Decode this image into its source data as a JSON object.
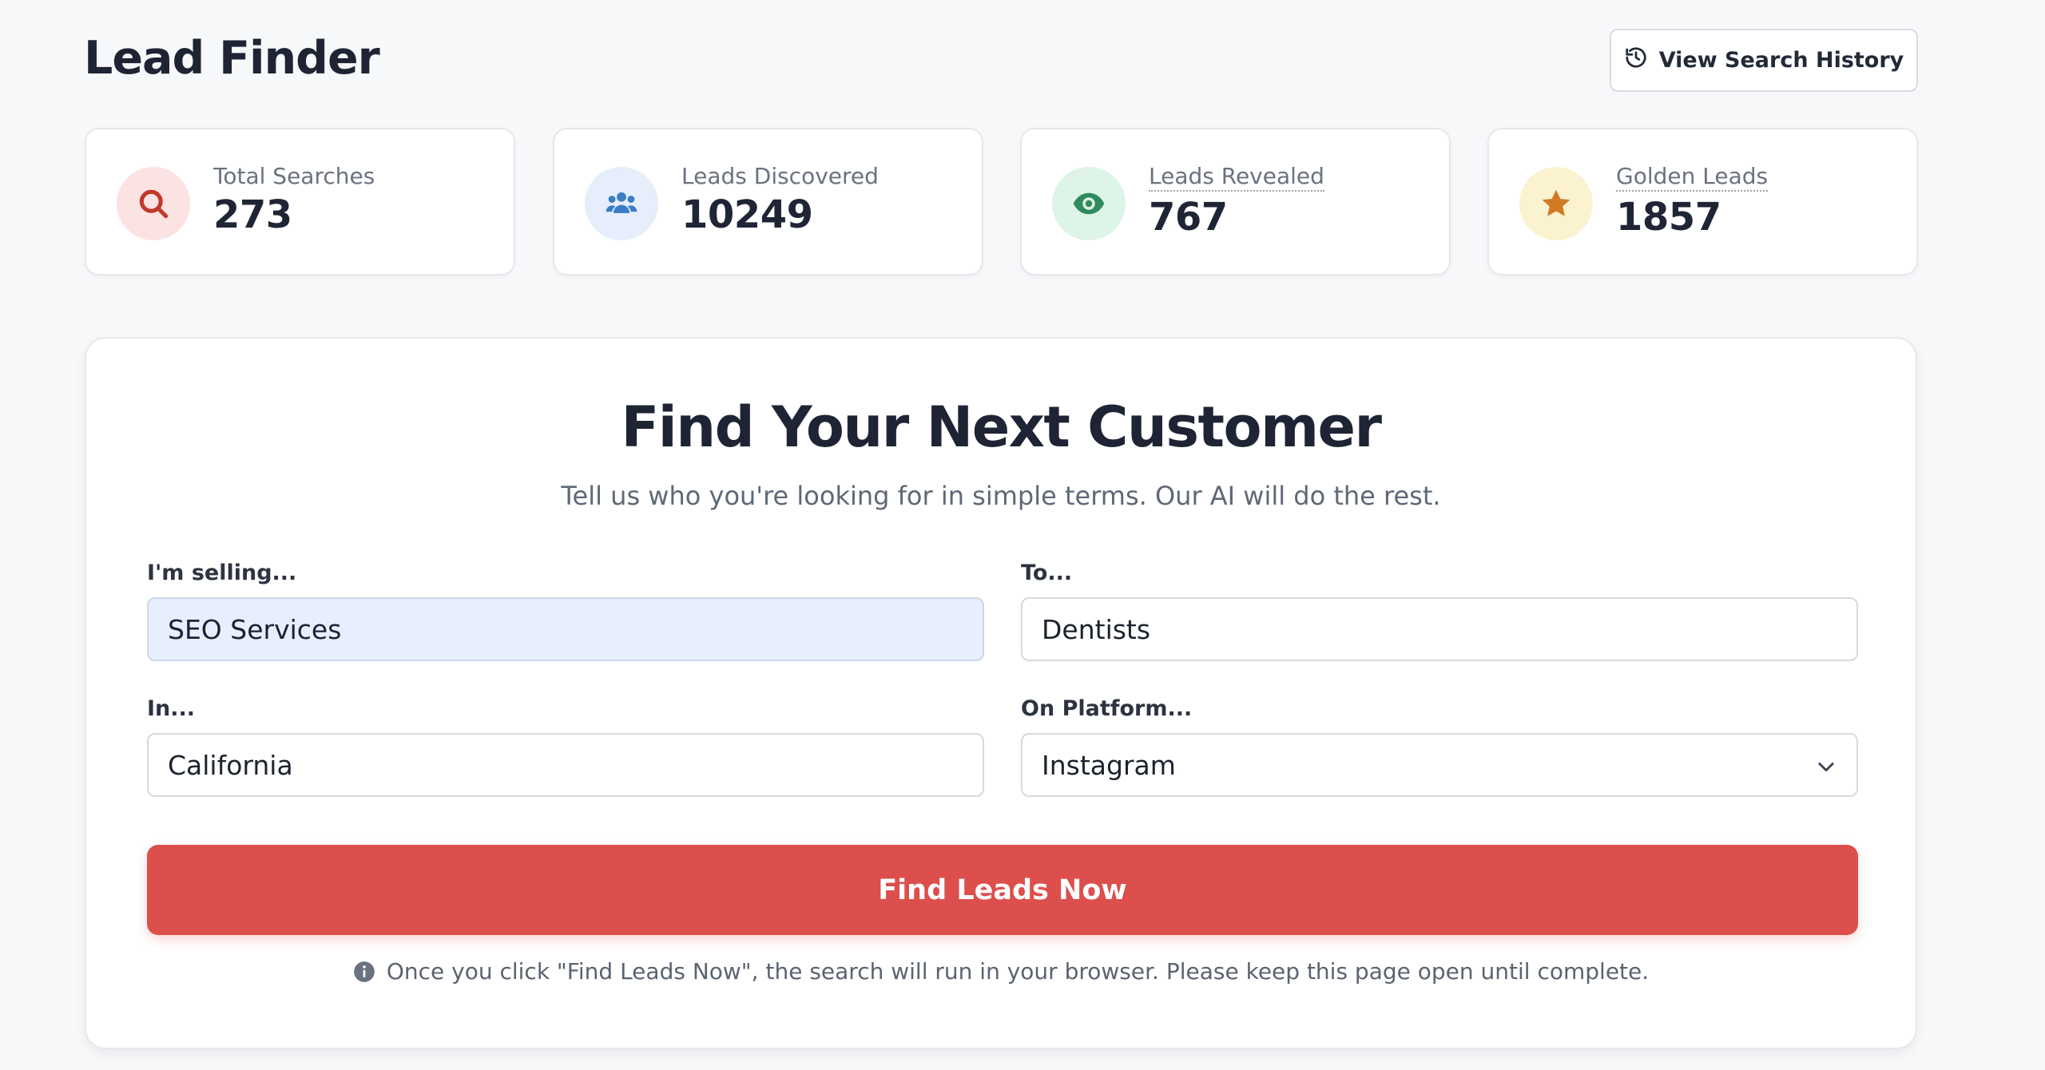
{
  "header": {
    "title": "Lead Finder",
    "history_button": "View Search History"
  },
  "stats": [
    {
      "label": "Total Searches",
      "value": "273",
      "icon": "search-icon",
      "color": "#c0392b",
      "bg": "#fbe3e3"
    },
    {
      "label": "Leads Discovered",
      "value": "10249",
      "icon": "users-icon",
      "color": "#3b7cc6",
      "bg": "#e5eefa"
    },
    {
      "label": "Leads Revealed",
      "value": "767",
      "icon": "eye-icon",
      "color": "#2f8a5c",
      "bg": "#ddf4e6"
    },
    {
      "label": "Golden Leads",
      "value": "1857",
      "icon": "star-icon",
      "color": "#d07a24",
      "bg": "#fbf2cf"
    }
  ],
  "main": {
    "title": "Find Your Next Customer",
    "subtitle": "Tell us who you're looking for in simple terms. Our AI will do the rest.",
    "fields": {
      "selling": {
        "label": "I'm selling...",
        "value": "SEO Services"
      },
      "to": {
        "label": "To...",
        "value": "Dentists"
      },
      "in": {
        "label": "In...",
        "value": "California"
      },
      "platform": {
        "label": "On Platform...",
        "value": "Instagram"
      }
    },
    "cta": "Find Leads Now",
    "note": "Once you click \"Find Leads Now\", the search will run in your browser. Please keep this page open until complete."
  }
}
